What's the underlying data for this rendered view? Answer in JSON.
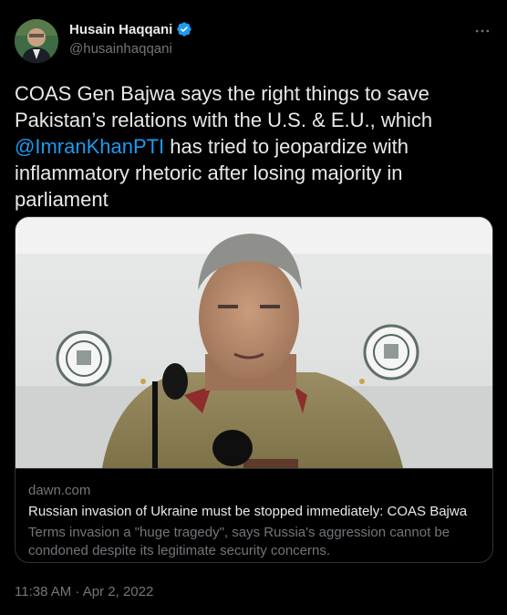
{
  "author": {
    "name": "Husain Haqqani",
    "handle": "@husainhaqqani",
    "verified": true,
    "verified_color": "#1d9bf0"
  },
  "more_icon": "more-horizontal-icon",
  "tweet": {
    "text_before": "COAS Gen Bajwa says the right things to save Pakistan’s relations with the U.S. & E.U., which ",
    "mention": "@ImranKhanPTI",
    "text_after": " has tried to jeopardize with inflammatory rhetoric after losing majority in parliament",
    "mention_color": "#1d9bf0"
  },
  "link_card": {
    "domain": "dawn.com",
    "title": "Russian invasion of Ukraine must be stopped immediately: COAS Bajwa",
    "description": "Terms invasion a \"huge tragedy\", says Russia's aggression cannot be condoned despite its legitimate security concerns."
  },
  "timestamp": "11:38 AM · Apr 2, 2022",
  "colors": {
    "background": "#000000",
    "text": "#e7e9ea",
    "secondary": "#71767b",
    "border": "#2f3336",
    "accent": "#1d9bf0"
  }
}
